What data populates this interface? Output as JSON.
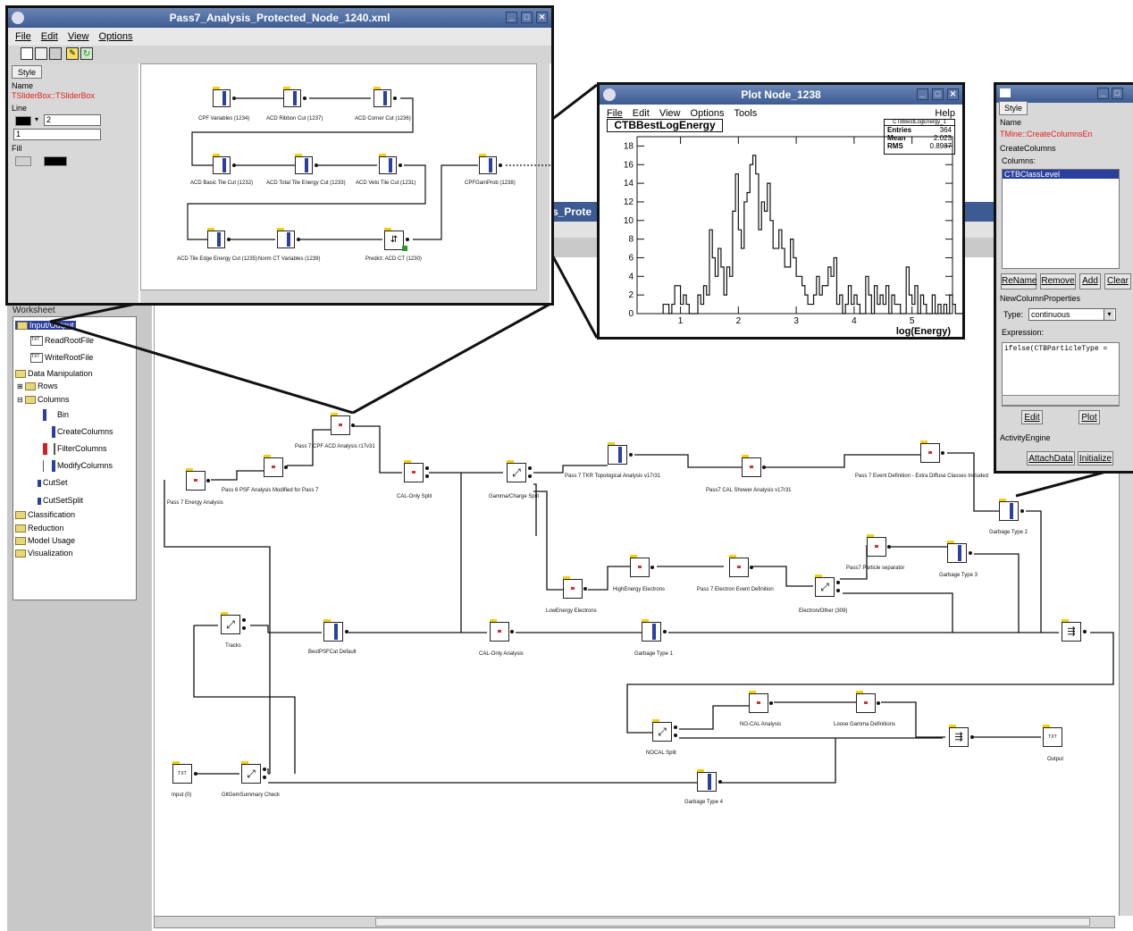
{
  "main_canvas": {
    "tree_header": "Worksheet",
    "partial_title": "s_Prote",
    "tree": [
      {
        "label": "Input/Output",
        "selected": true
      },
      {
        "label": "ReadRootFile"
      },
      {
        "label": "WriteRootFile"
      },
      {
        "label": "Data Manipulation"
      },
      {
        "label": "Rows"
      },
      {
        "label": "Columns"
      },
      {
        "label": "Bin"
      },
      {
        "label": "CreateColumns"
      },
      {
        "label": "FilterColumns"
      },
      {
        "label": "ModifyColumns"
      },
      {
        "label": "CutSet"
      },
      {
        "label": "CutSetSplit"
      },
      {
        "label": "Classification"
      },
      {
        "label": "Reduction"
      },
      {
        "label": "Model Usage"
      },
      {
        "label": "Visualization"
      }
    ],
    "nodes": [
      "Pass 7 CPF ACD Analysis r17v31",
      "Pass 6 PSF Analysis  Modified for Pass 7",
      "Pass 7 Energy Analysis",
      "CAL-Only Split",
      "Gamma/Charge Split",
      "Pass 7 TKR Topological Analysis v17r31",
      "Pass7 CAL Shower Analysis v17r31",
      "Pass 7 Event Definition - Extra Diffuse Classes Included",
      "Garbage Type 2",
      "Pass7 Particle separator",
      "Garbage Type 3",
      "HighEnergy Electrons",
      "Pass 7 Electron Event Definition",
      "Electron/Other (309)",
      "LowEnergy Electrons",
      "Tracks",
      "BestPSFCat Default",
      "CAL-Only Analysis",
      "Garbage Type 1",
      "NO-CAL Analysis",
      "Loose Gamma Definitions",
      "NOCAL Split",
      "Output",
      "Input (0)",
      "GltGemSummary Check",
      "Garbage Type 4"
    ]
  },
  "xml_window": {
    "title": "Pass7_Analysis_Protected_Node_1240.xml",
    "menu": [
      "File",
      "Edit",
      "View",
      "Options"
    ],
    "style_tab": "Style",
    "name_label": "Name",
    "name_value": "TSliderBox::TSliderBox",
    "line_label": "Line",
    "line_width": "2",
    "line_style": "1",
    "fill_label": "Fill",
    "nodes": [
      "CPF Variables (1234)",
      "ACD Ribbon Cut (1237)",
      "ACD Corner Cut (1236)",
      "ACD Basic Tile Cut  (1232)",
      "ACD Total Tile Energy Cut (1233)",
      "ACD Veto Tile Cut   (1231)",
      "CPFGamProb (1238)",
      "ACD Tile Edge Energy Cut (1235)",
      "Norm CT Variables (1239)",
      "Predict: ACD CT  (1230)"
    ]
  },
  "plot_window": {
    "title": "Plot Node_1238",
    "menu": [
      "File",
      "Edit",
      "View",
      "Options",
      "Tools"
    ],
    "help": "Help",
    "stats": {
      "name": "CTBBestLogEnergy_1",
      "entries_label": "Entries",
      "entries": "364",
      "mean_label": "Mean",
      "mean": "2.023",
      "rms_label": "RMS",
      "rms": "0.8987"
    }
  },
  "chart_data": {
    "type": "histogram",
    "title": "CTBBestLogEnergy",
    "xlabel": "log(Energy)",
    "ylabel": "",
    "xlim": [
      0.25,
      5.7
    ],
    "ylim": [
      0,
      19
    ],
    "xticks": [
      "1",
      "2",
      "3",
      "4",
      "5"
    ],
    "yticks": [
      "0",
      "2",
      "4",
      "6",
      "8",
      "10",
      "12",
      "14",
      "16",
      "18"
    ],
    "bin_start": 0.7,
    "bin_width": 0.05,
    "values": [
      1,
      1,
      0,
      1,
      3,
      3,
      1,
      2,
      1,
      0,
      0,
      0,
      2,
      1,
      3,
      2,
      9,
      6,
      4,
      7,
      5,
      2,
      5,
      4,
      11,
      15,
      9,
      7,
      12,
      13,
      16,
      17,
      15,
      9,
      12,
      11,
      14,
      10,
      7,
      7,
      9,
      7,
      5,
      5,
      8,
      6,
      4,
      4,
      3,
      2,
      1,
      1,
      2,
      4,
      2,
      3,
      3,
      5,
      4,
      6,
      1,
      2,
      0,
      1,
      3,
      1,
      2,
      1,
      0,
      0,
      4,
      2,
      0,
      3,
      1,
      2,
      1,
      3,
      0,
      2,
      1,
      1,
      0,
      0,
      5,
      2,
      1,
      3,
      0,
      2,
      1,
      0,
      0,
      2,
      0,
      1,
      0,
      1,
      0,
      2,
      1,
      0,
      0,
      0,
      1,
      0,
      0,
      0,
      1,
      0,
      0,
      0,
      1,
      0,
      0,
      0,
      0,
      1,
      0,
      0,
      0,
      0,
      0,
      0,
      0,
      0,
      0,
      0,
      1,
      0
    ]
  },
  "style_window": {
    "style_tab": "Style",
    "name_label": "Name",
    "name_value": "TMine::CreateColumnsEn",
    "create_label": "CreateColumns",
    "columns_label": "Columns:",
    "column_item": "CTBClassLevel",
    "btn_rename": "ReName",
    "btn_remove": "Remove",
    "btn_add": "Add",
    "btn_clear": "Clear",
    "new_col_label": "NewColumnProperties",
    "type_label": "Type:",
    "type_value": "continuous",
    "expression_label": "Expression:",
    "expression_value": "ifelse(CTBParticleType =",
    "btn_edit": "Edit",
    "btn_plot": "Plot",
    "activity_label": "ActivityEngine",
    "btn_attach": "AttachData",
    "btn_initialize": "Initialize"
  },
  "colors": {
    "accent": "#2a3f9e",
    "node_tab": "#f2d20c",
    "title_bar": "#3d5b92",
    "red_text": "#e02020"
  }
}
